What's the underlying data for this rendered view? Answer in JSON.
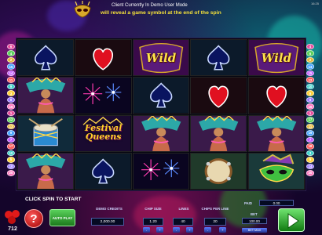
{
  "banner": {
    "demo_text": "Client Currently In Demo User Mode",
    "reveal_text": "will reveal a game symbol at the end of the spin",
    "status": "16:25"
  },
  "paylines": {
    "left": [
      "6",
      "4",
      "2",
      "15",
      "14",
      "11",
      "9",
      "3",
      "8",
      "16",
      "1",
      "12",
      "13",
      "9",
      "7",
      "17",
      "10",
      "5",
      "10",
      "20"
    ],
    "right": [
      "4",
      "6",
      "2",
      "13",
      "15",
      "12",
      "10",
      "9",
      "8",
      "16",
      "1",
      "17",
      "11",
      "19",
      "7",
      "18",
      "3",
      "5",
      "14",
      "20"
    ],
    "colors": [
      "#e84b9c",
      "#5bd15b",
      "#e8b83a",
      "#4aa6ff",
      "#c45bff",
      "#ff5a5a",
      "#3ad0c8",
      "#ffd23a",
      "#9a7aff",
      "#ff7ac0"
    ]
  },
  "reels": [
    [
      "spade-icon",
      "dancer-icon",
      "drum-icon",
      "dancer-icon"
    ],
    [
      "heart-icon",
      "fireworks-icon",
      "festival-queens-logo",
      "spade-icon"
    ],
    [
      "wild-icon",
      "spade-icon",
      "dancer-icon",
      "fireworks-icon"
    ],
    [
      "spade-icon",
      "heart-icon",
      "dancer-icon",
      "tambourine-icon"
    ],
    [
      "wild-icon",
      "heart-icon",
      "dancer-icon",
      "mask-icon"
    ]
  ],
  "symbols": {
    "wild": "Wild",
    "festival_queens": [
      "Festival",
      "Queens"
    ]
  },
  "bottom": {
    "click_spin": "CLICK SPIN TO START",
    "logo": "712",
    "help": "?",
    "autoplay": "AUTO PLAY",
    "demo_credits_label": "DEMO CREDITS",
    "demo_credits_value": "2,000.00",
    "chip_size_label": "CHIP SIZE",
    "chip_size_value": "1.20",
    "lines_label": "LINES",
    "lines_value": "40",
    "chips_per_line_label": "CHIPS PER LINE",
    "chips_per_line_value": "20",
    "paid_label": "PAID",
    "paid_value": "0.00",
    "bet_label": "BET",
    "bet_value": "100.00",
    "bet_max": "BET MAX",
    "minus": "-",
    "plus": "+"
  }
}
